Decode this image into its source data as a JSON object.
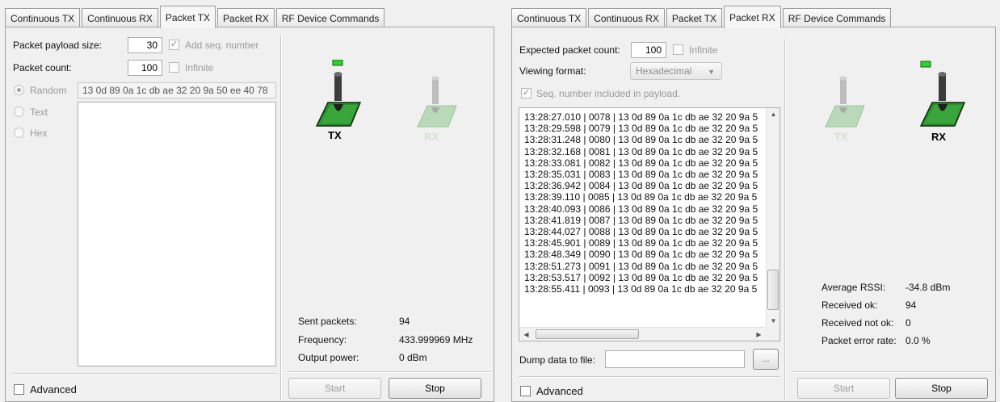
{
  "left": {
    "tabs": [
      "Continuous TX",
      "Continuous RX",
      "Packet TX",
      "Packet RX",
      "RF Device Commands"
    ],
    "active_tab": "Packet TX",
    "payload_size_label": "Packet payload size:",
    "payload_size_value": "30",
    "add_seq_label": "Add seq. number",
    "packet_count_label": "Packet count:",
    "packet_count_value": "100",
    "infinite_label": "Infinite",
    "random_label": "Random",
    "random_value": "13 0d 89 0a 1c db ae 32 20 9a 50 ee 40 78",
    "text_label": "Text",
    "hex_label": "Hex",
    "advanced_label": "Advanced",
    "tx_label": "TX",
    "rx_label": "RX",
    "sent_packets_label": "Sent packets:",
    "sent_packets_value": "94",
    "frequency_label": "Frequency:",
    "frequency_value": "433.999969 MHz",
    "output_power_label": "Output power:",
    "output_power_value": "0 dBm",
    "start_label": "Start",
    "stop_label": "Stop",
    "led_color": "#2fd12f",
    "pcb_color": "#2e8b2e"
  },
  "right": {
    "tabs": [
      "Continuous TX",
      "Continuous RX",
      "Packet TX",
      "Packet RX",
      "RF Device Commands"
    ],
    "active_tab": "Packet RX",
    "expected_count_label": "Expected packet count:",
    "expected_count_value": "100",
    "infinite_label": "Infinite",
    "viewing_format_label": "Viewing format:",
    "viewing_format_value": "Hexadecimal",
    "seq_included_label": "Seq. number included in payload.",
    "log_lines": [
      "13:28:27.010 | 0078 | 13 0d 89 0a 1c db ae 32 20 9a 5",
      "13:28:29.598 | 0079 | 13 0d 89 0a 1c db ae 32 20 9a 5",
      "13:28:31.248 | 0080 | 13 0d 89 0a 1c db ae 32 20 9a 5",
      "13:28:32.168 | 0081 | 13 0d 89 0a 1c db ae 32 20 9a 5",
      "13:28:33.081 | 0082 | 13 0d 89 0a 1c db ae 32 20 9a 5",
      "13:28:35.031 | 0083 | 13 0d 89 0a 1c db ae 32 20 9a 5",
      "13:28:36.942 | 0084 | 13 0d 89 0a 1c db ae 32 20 9a 5",
      "13:28:39.110 | 0085 | 13 0d 89 0a 1c db ae 32 20 9a 5",
      "13:28:40.093 | 0086 | 13 0d 89 0a 1c db ae 32 20 9a 5",
      "13:28:41.819 | 0087 | 13 0d 89 0a 1c db ae 32 20 9a 5",
      "13:28:44.027 | 0088 | 13 0d 89 0a 1c db ae 32 20 9a 5",
      "13:28:45.901 | 0089 | 13 0d 89 0a 1c db ae 32 20 9a 5",
      "13:28:48.349 | 0090 | 13 0d 89 0a 1c db ae 32 20 9a 5",
      "13:28:51.273 | 0091 | 13 0d 89 0a 1c db ae 32 20 9a 5",
      "13:28:53.517 | 0092 | 13 0d 89 0a 1c db ae 32 20 9a 5",
      "13:28:55.411 | 0093 | 13 0d 89 0a 1c db ae 32 20 9a 5"
    ],
    "dump_label": "Dump data to file:",
    "dump_value": "",
    "browse_label": "...",
    "advanced_label": "Advanced",
    "tx_label": "TX",
    "rx_label": "RX",
    "avg_rssi_label": "Average RSSI:",
    "avg_rssi_value": "-34.8 dBm",
    "received_ok_label": "Received ok:",
    "received_ok_value": "94",
    "received_not_ok_label": "Received not ok:",
    "received_not_ok_value": "0",
    "per_label": "Packet error rate:",
    "per_value": "0.0 %",
    "start_label": "Start",
    "stop_label": "Stop",
    "led_color": "#2fd12f",
    "pcb_color": "#2e8b2e"
  }
}
